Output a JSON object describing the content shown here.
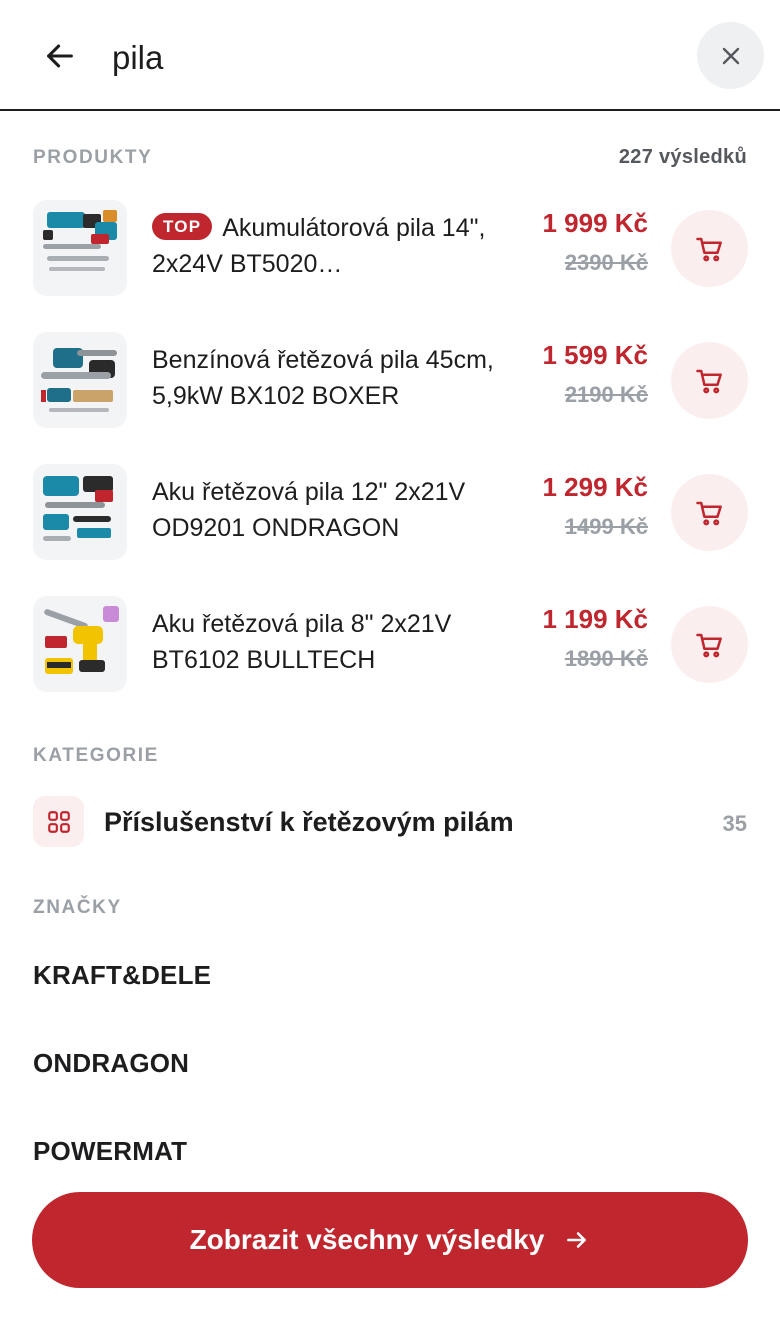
{
  "search": {
    "query": "pila"
  },
  "products_section": {
    "title": "PRODUKTY",
    "count": "227 výsledků",
    "items": [
      {
        "badge": "TOP",
        "name": "Akumulátorová pila 14\", 2x24V BT5020…",
        "price": "1 999 Kč",
        "old_price": "2390 Kč"
      },
      {
        "badge": "",
        "name": "Benzínová řetězová pila 45cm, 5,9kW BX102 BOXER",
        "price": "1 599 Kč",
        "old_price": "2190 Kč"
      },
      {
        "badge": "",
        "name": "Aku řetězová pila 12\" 2x21V OD9201 ONDRAGON",
        "price": "1 299 Kč",
        "old_price": "1499 Kč"
      },
      {
        "badge": "",
        "name": "Aku řetězová pila 8\" 2x21V BT6102 BULLTECH",
        "price": "1 199 Kč",
        "old_price": "1890 Kč"
      }
    ]
  },
  "categories_section": {
    "title": "KATEGORIE",
    "items": [
      {
        "label": "Příslušenství k řetězovým pilám",
        "count": "35",
        "icon": "grid-icon"
      }
    ]
  },
  "brands_section": {
    "title": "ZNAČKY",
    "items": [
      "KRAFT&DELE",
      "ONDRAGON",
      "POWERMAT"
    ]
  },
  "cta": {
    "label": "Zobrazit všechny výsledky"
  },
  "colors": {
    "accent": "#c0262e",
    "accent_soft": "#fbeeee",
    "muted": "#9aa0a6",
    "text": "#1d1d1f"
  }
}
